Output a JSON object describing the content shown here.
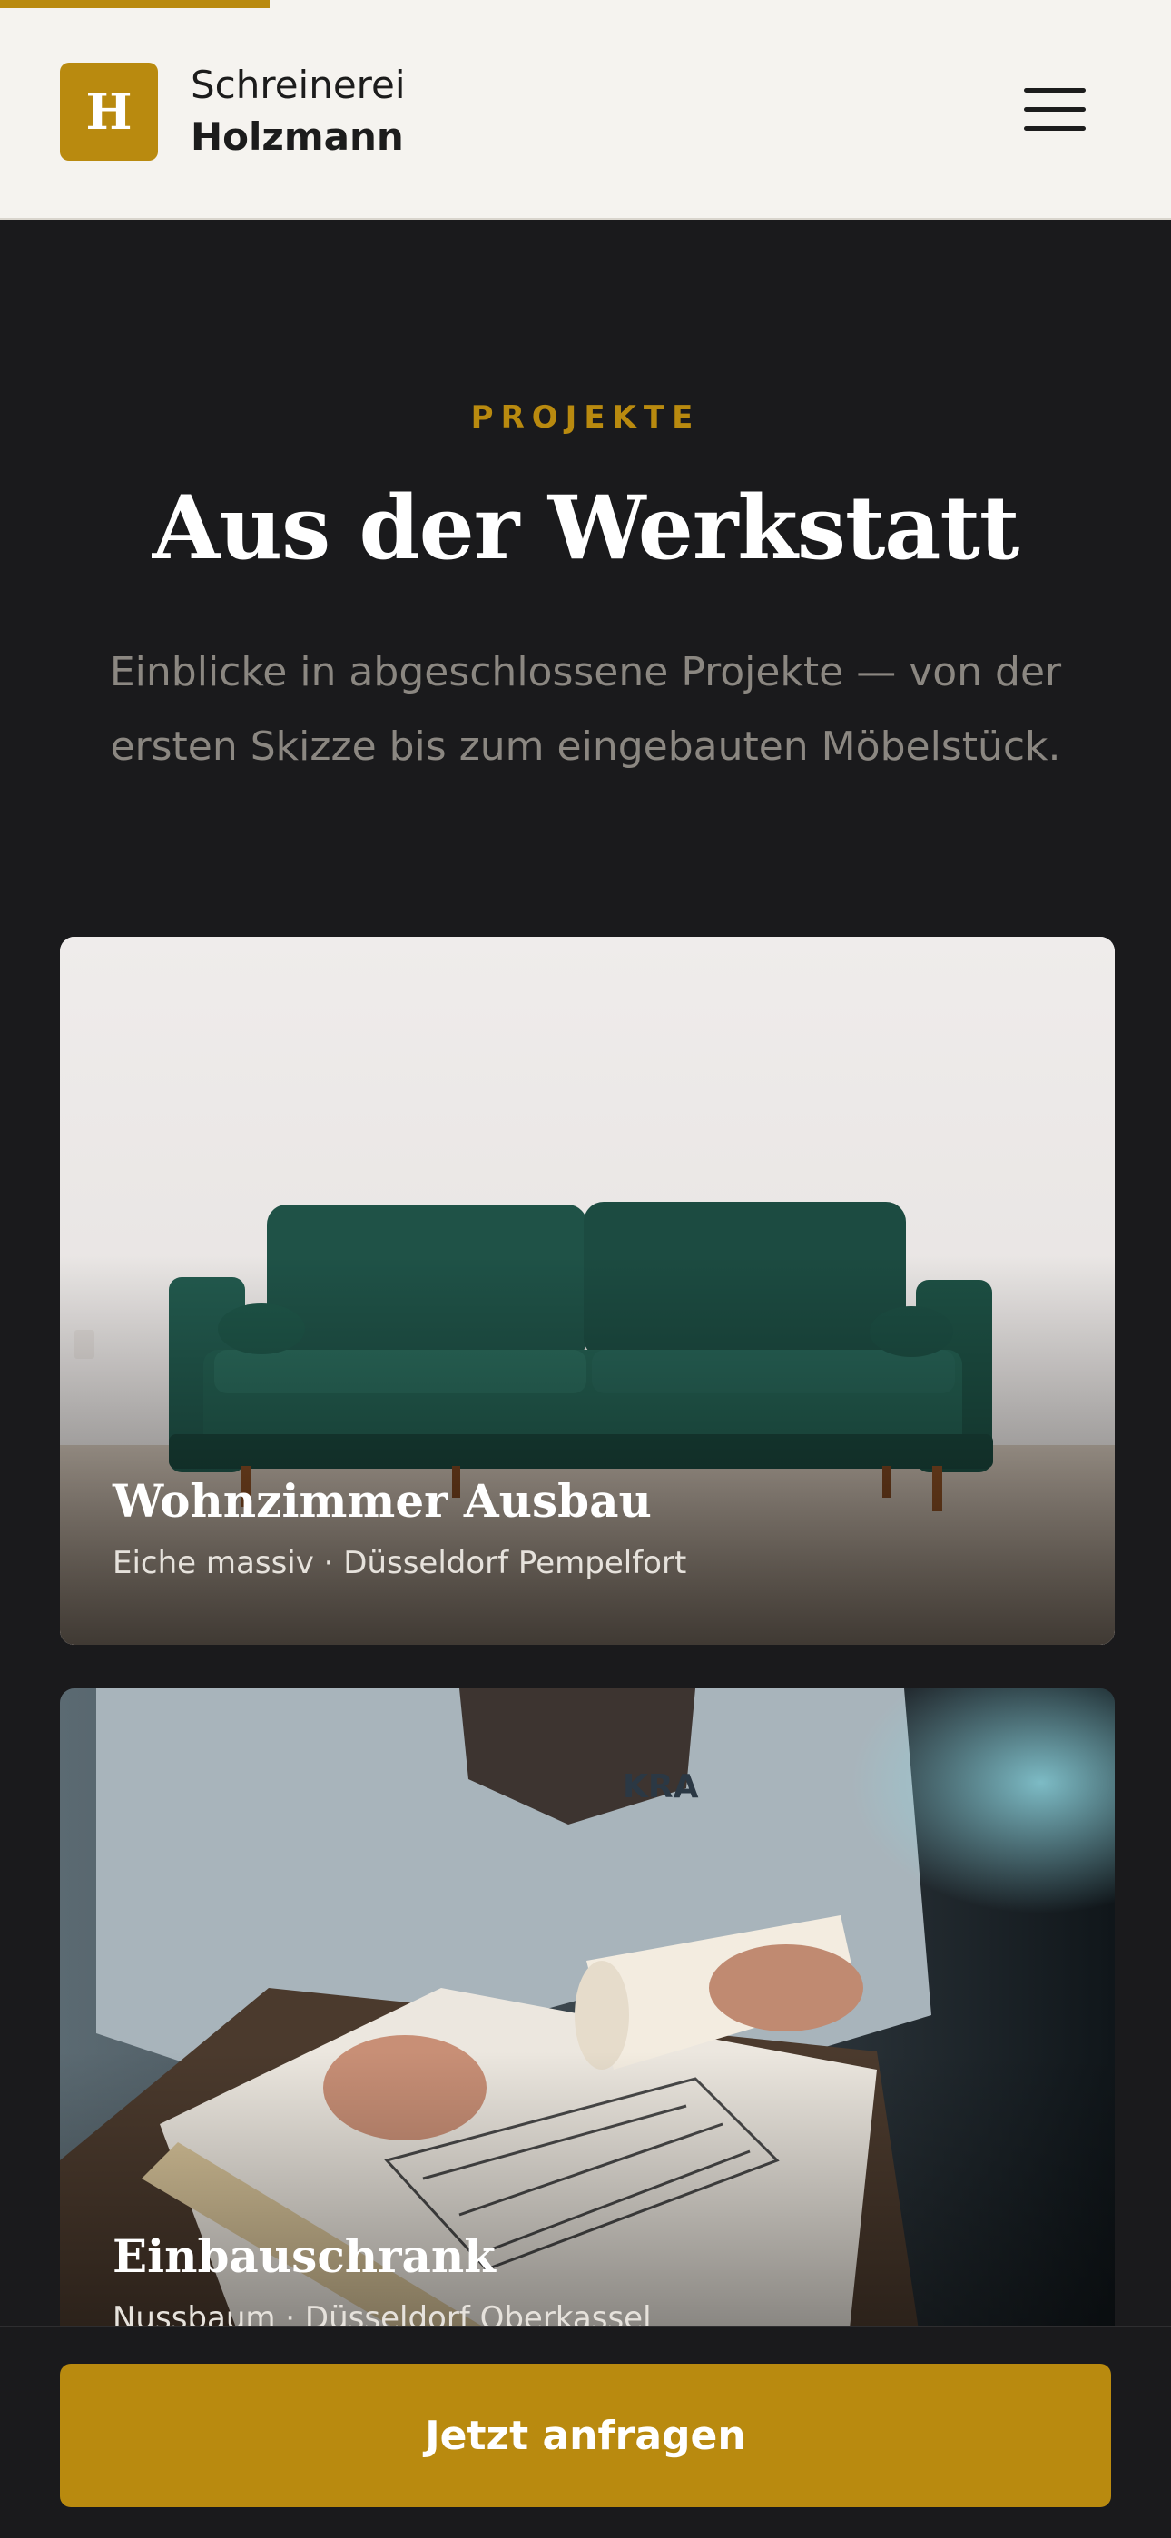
{
  "header": {
    "logo_letter": "H",
    "brand_line1": "Schreinerei",
    "brand_line2": "Holzmann",
    "menu_icon": "hamburger-menu-icon",
    "scroll_progress": 0.23
  },
  "intro": {
    "eyebrow": "PROJEKTE",
    "title": "Aus der Werkstatt",
    "subtitle": "Einblicke in abgeschlossene Projekte — von der ersten Skizze bis zum eingebauten Möbelstück."
  },
  "projects": [
    {
      "title": "Wohnzimmer Ausbau",
      "meta": "Eiche massiv · Düsseldorf Pempelfort",
      "image": "green-velvet-sofa-photo"
    },
    {
      "title": "Einbauschrank",
      "meta": "Nussbaum · Düsseldorf Oberkassel",
      "image": "carpenter-drawing-plans-photo"
    }
  ],
  "cta": {
    "label": "Jetzt anfragen"
  },
  "colors": {
    "accent": "#b98a0f",
    "background": "#1a1a1c",
    "header_bg": "#f5f3ef"
  }
}
